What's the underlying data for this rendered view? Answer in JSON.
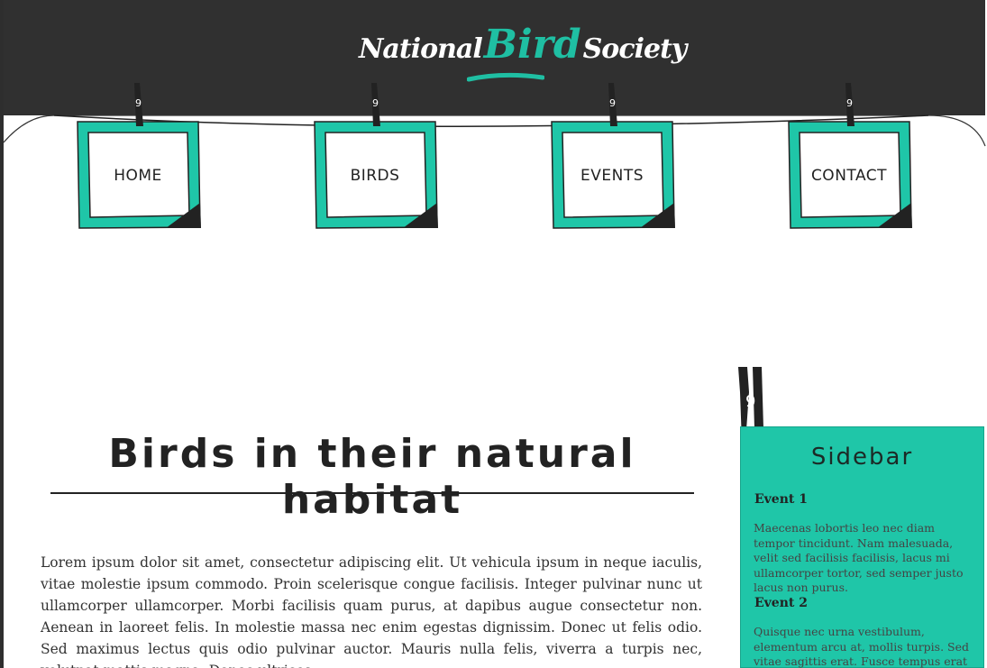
{
  "logo": {
    "word1": "National",
    "word2": "Bird",
    "word3": "Society"
  },
  "nav": {
    "items": [
      {
        "label": "Home"
      },
      {
        "label": "Birds"
      },
      {
        "label": "Events"
      },
      {
        "label": "Contact"
      }
    ]
  },
  "main": {
    "title": "Birds in their natural habitat",
    "paragraph": "Lorem ipsum dolor sit amet, consectetur adipiscing elit. Ut vehicula ipsum in neque iaculis, vitae molestie ipsum commodo. Proin scelerisque congue facilisis. Integer pulvinar nunc ut ullamcorper ullamcorper. Morbi facilisis quam purus, at dapibus augue consectetur non. Aenean in laoreet felis. In molestie massa nec enim egestas dignissim. Donec ut felis odio. Sed maximus lectus quis odio pulvinar auctor. Mauris nulla felis, viverra a turpis nec, volutpat mattis magna. Donec ultrices"
  },
  "sidebar": {
    "title": "Sidebar",
    "events": [
      {
        "heading": "Event 1",
        "text": "Maecenas lobortis leo nec diam tempor tincidunt. Nam malesuada, velit sed facilisis facilisis, lacus mi ullamcorper tortor, sed semper justo lacus non purus."
      },
      {
        "heading": "Event 2",
        "text": "Quisque nec urna vestibulum, elementum arcu at, mollis turpis. Sed vitae sagittis erat. Fusce tempus erat a"
      }
    ]
  },
  "colors": {
    "header_bg": "#303030",
    "accent": "#1fc6a8",
    "text": "#222222"
  },
  "icons": [
    "clothespin-icon"
  ]
}
